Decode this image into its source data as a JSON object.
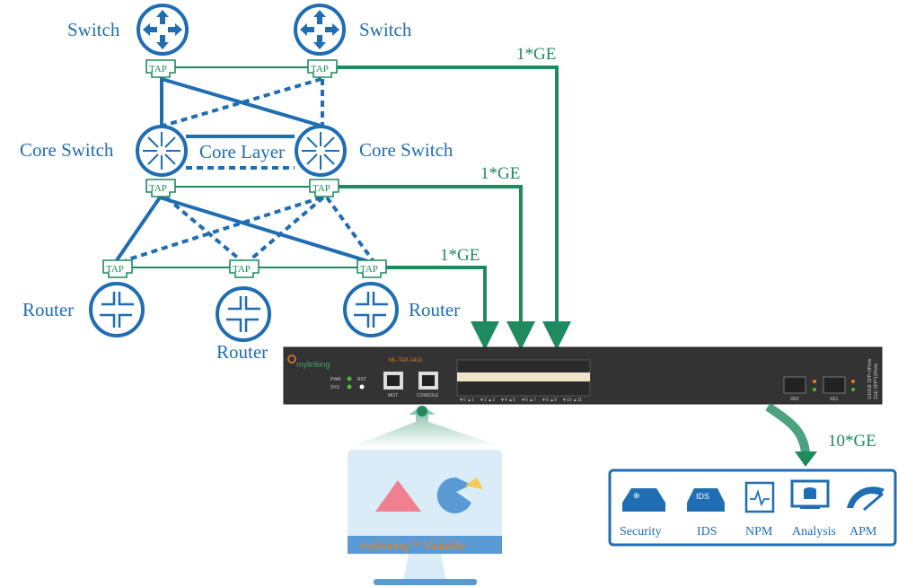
{
  "colors": {
    "blue": "#1f6db3",
    "green": "#1f8a5e",
    "device": "#333333",
    "orange": "#e8801e"
  },
  "labels": {
    "switch_left": "Switch",
    "switch_right": "Switch",
    "core_left": "Core Switch",
    "core_right": "Core Switch",
    "core_layer": "Core Layer",
    "router_left": "Router",
    "router_mid": "Router",
    "router_right": "Router",
    "tap": "TAP"
  },
  "links": {
    "top": "1*GE",
    "mid": "1*GE",
    "bottom": "1*GE",
    "out": "10*GE"
  },
  "device": {
    "brand": "mylinking",
    "tm": "TM",
    "model": "ML-TAP-1410",
    "pwr": "PWR",
    "sys": "SYS",
    "rst": "RST",
    "mgt": "MGT",
    "console": "CONSOLE",
    "ports": [
      "▼0 ▲1",
      "▼2 ▲3",
      "▼4 ▲5",
      "▼6 ▲7",
      "▼8 ▲9",
      "▼10 ▲11"
    ],
    "xe": [
      "XE0",
      "XE1"
    ],
    "side1": "1/10GE SFP+2Ports",
    "side2": "1GE SFP*12Ports"
  },
  "monitor": {
    "caption": "mylinking™ Visibility"
  },
  "services": [
    {
      "label": "Security",
      "icon": "security-appliance-icon"
    },
    {
      "label": "IDS",
      "icon": "ids-appliance-icon"
    },
    {
      "label": "NPM",
      "icon": "npm-icon"
    },
    {
      "label": "Analysis",
      "icon": "analysis-monitor-icon"
    },
    {
      "label": "APM",
      "icon": "gauge-icon"
    }
  ],
  "ids_badge": "IDS"
}
